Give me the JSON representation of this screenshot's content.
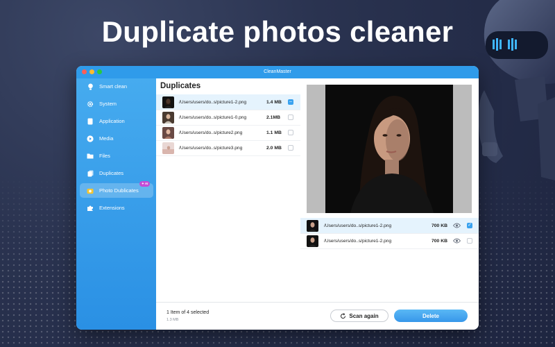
{
  "headline": "Duplicate photos cleaner",
  "window": {
    "title": "CleanMaster"
  },
  "colors": {
    "accent": "#2f9bea",
    "ai_badge": "#c44bd6",
    "selected_row": "#e5f3fd"
  },
  "sidebar": {
    "items": [
      {
        "label": "Smart clean",
        "icon": "bulb-icon",
        "active": false
      },
      {
        "label": "System",
        "icon": "gear-icon",
        "active": false
      },
      {
        "label": "Application",
        "icon": "app-icon",
        "active": false
      },
      {
        "label": "Media",
        "icon": "play-icon",
        "active": false
      },
      {
        "label": "Files",
        "icon": "folder-icon",
        "active": false
      },
      {
        "label": "Duplicates",
        "icon": "duplicate-icon",
        "active": false
      },
      {
        "label": "Photo Dublicates",
        "icon": "photo-icon",
        "active": true,
        "badge": "✦ AI"
      },
      {
        "label": "Extensions",
        "icon": "puzzle-icon",
        "active": false
      }
    ]
  },
  "duplicates": {
    "title": "Duplicates",
    "rows": [
      {
        "path": "/Users/users/do..s/picture1-2.png",
        "size": "1.4 MB",
        "checked": "partial",
        "selected": true
      },
      {
        "path": "/Users/users/do..s/picture1-0.png",
        "size": "2.1MB",
        "checked": false,
        "selected": false
      },
      {
        "path": "/Users/users/do..s/picture2.png",
        "size": "1.1 MB",
        "checked": false,
        "selected": false
      },
      {
        "path": "/Users/users/do..s/picture3.png",
        "size": "2.0 MB",
        "checked": false,
        "selected": false
      }
    ]
  },
  "preview": {
    "rows": [
      {
        "path": "/Users/users/do..s/picture1-2.png",
        "size": "700 KB",
        "checked": true
      },
      {
        "path": "/Users/users/do..s/picture1-2.png",
        "size": "700 KB",
        "checked": false
      }
    ]
  },
  "footer": {
    "selection": "1 Item of 4 selected",
    "selection_size": "1.3 MB",
    "scan_label": "Scan again",
    "delete_label": "Delete"
  }
}
